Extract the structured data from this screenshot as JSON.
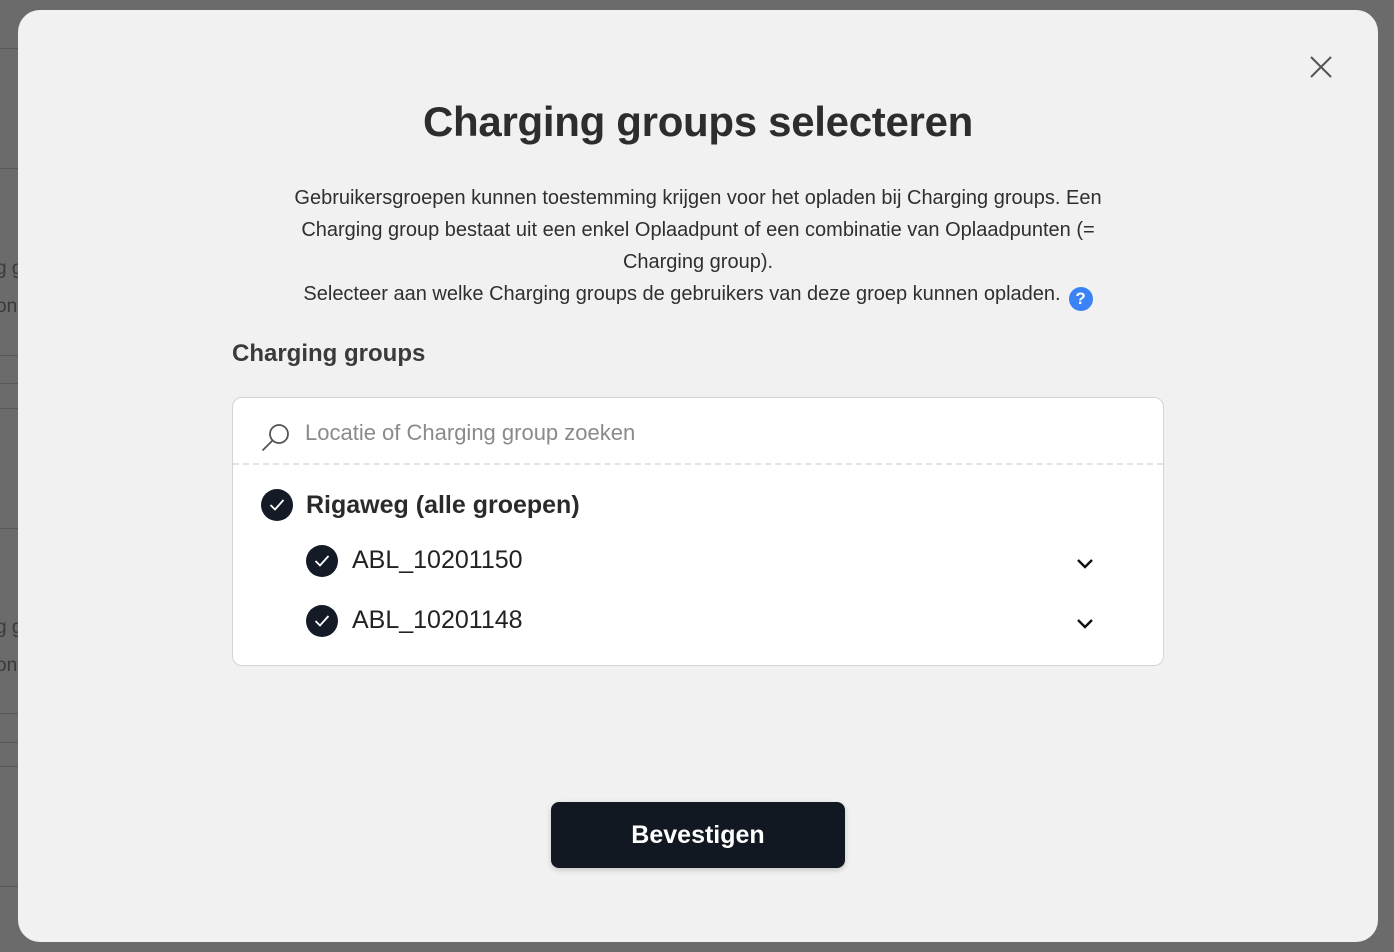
{
  "background": {
    "fragments": [
      "g g",
      "on",
      "g g",
      "on"
    ]
  },
  "modal": {
    "title": "Charging groups selecteren",
    "description_lines": [
      "Gebruikersgroepen kunnen toestemming krijgen voor het opladen bij Charging groups. Een",
      "Charging group bestaat uit een enkel Oplaadpunt of een combinatie van Oplaadpunten (=",
      "Charging group).",
      "Selecteer aan welke Charging groups de gebruikers van deze groep kunnen opladen."
    ],
    "help_icon": "?",
    "section_label": "Charging groups",
    "search": {
      "placeholder": "Locatie of Charging group zoeken",
      "value": ""
    },
    "location": {
      "label": "Rigaweg (alle groepen)",
      "checked": true
    },
    "groups": [
      {
        "label": "ABL_10201150",
        "checked": true
      },
      {
        "label": "ABL_10201148",
        "checked": true
      }
    ],
    "confirm_label": "Bevestigen",
    "colors": {
      "accent": "#3b82f6",
      "primary_dark": "#121822",
      "modal_bg": "#f1f1f1"
    }
  }
}
